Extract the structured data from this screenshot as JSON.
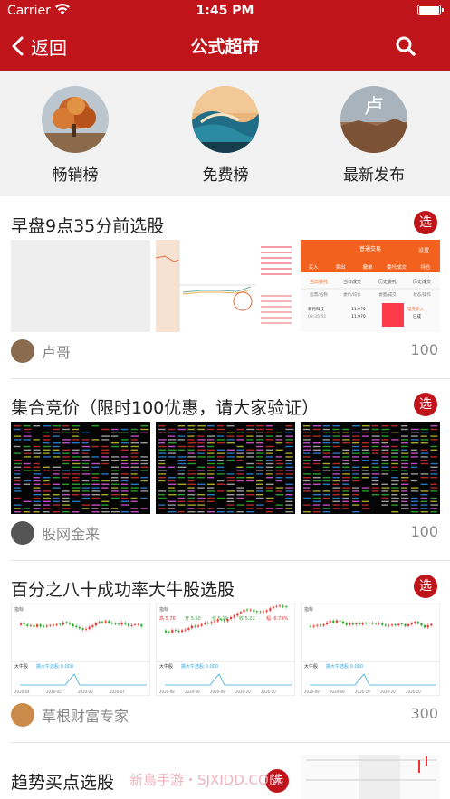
{
  "status_bar": {
    "carrier": "Carrier",
    "time": "1:45 PM"
  },
  "nav": {
    "back_label": "返回",
    "title": "公式超市"
  },
  "categories": [
    {
      "label": "畅销榜"
    },
    {
      "label": "免费榜"
    },
    {
      "label": "最新发布",
      "avatar_char": "卢"
    }
  ],
  "items": [
    {
      "title": "早盘9点35分前选股",
      "badge": "选",
      "author": "卢哥",
      "price": "100"
    },
    {
      "title": "集合竞价（限时100优惠，请大家验证）",
      "badge": "选",
      "author": "股网金来",
      "price": "100"
    },
    {
      "title": "百分之八十成功率大牛股选股",
      "badge": "选",
      "author": "草根财富专家",
      "price": "300"
    },
    {
      "title": "趋势买点选股",
      "badge": "选"
    }
  ],
  "thumb_text": {
    "app_tabs": [
      "买入",
      "卖出",
      "撤单",
      "委托成交",
      "持仓"
    ],
    "app_subtabs": [
      "当日委托",
      "当日成交",
      "历史委托",
      "历史成交"
    ],
    "app_cols": [
      "股票/名称",
      "委价/均价",
      "委量/成交",
      "状态/操作"
    ],
    "app_row_name": "新元科技",
    "app_row_time": "09:35:51",
    "app_row_price": "11.970",
    "app_row_price2": "11.970",
    "app_row_status": "已成",
    "app_row_status_tag": "证券买入",
    "app_header": "普通交易",
    "app_header_right": "设置",
    "chart_head": "指标",
    "indicator_label": "大牛股",
    "indicator_text": "擒大牛选股:0.000",
    "kline2_stats": [
      "高 5.76",
      "开 5.50",
      "低 5.19",
      "收 5.22",
      "幅 -6.79%"
    ],
    "kline1_dates": [
      "2020-04",
      "2020-05",
      "2020-06",
      "2020-07"
    ],
    "kline2_dates": [
      "2020-08",
      "2020-09",
      "2020-09",
      "2020-10",
      "2020-10"
    ],
    "kline3_dates": [
      "2020-09",
      "2020-09",
      "2020-10",
      "2020-10",
      "2020-10"
    ]
  },
  "watermark": "新島手游・SJXIDD.COM",
  "colors": {
    "brand_red": "#c0141b",
    "background_gray": "#f2f2f2",
    "muted_text": "#888888"
  }
}
